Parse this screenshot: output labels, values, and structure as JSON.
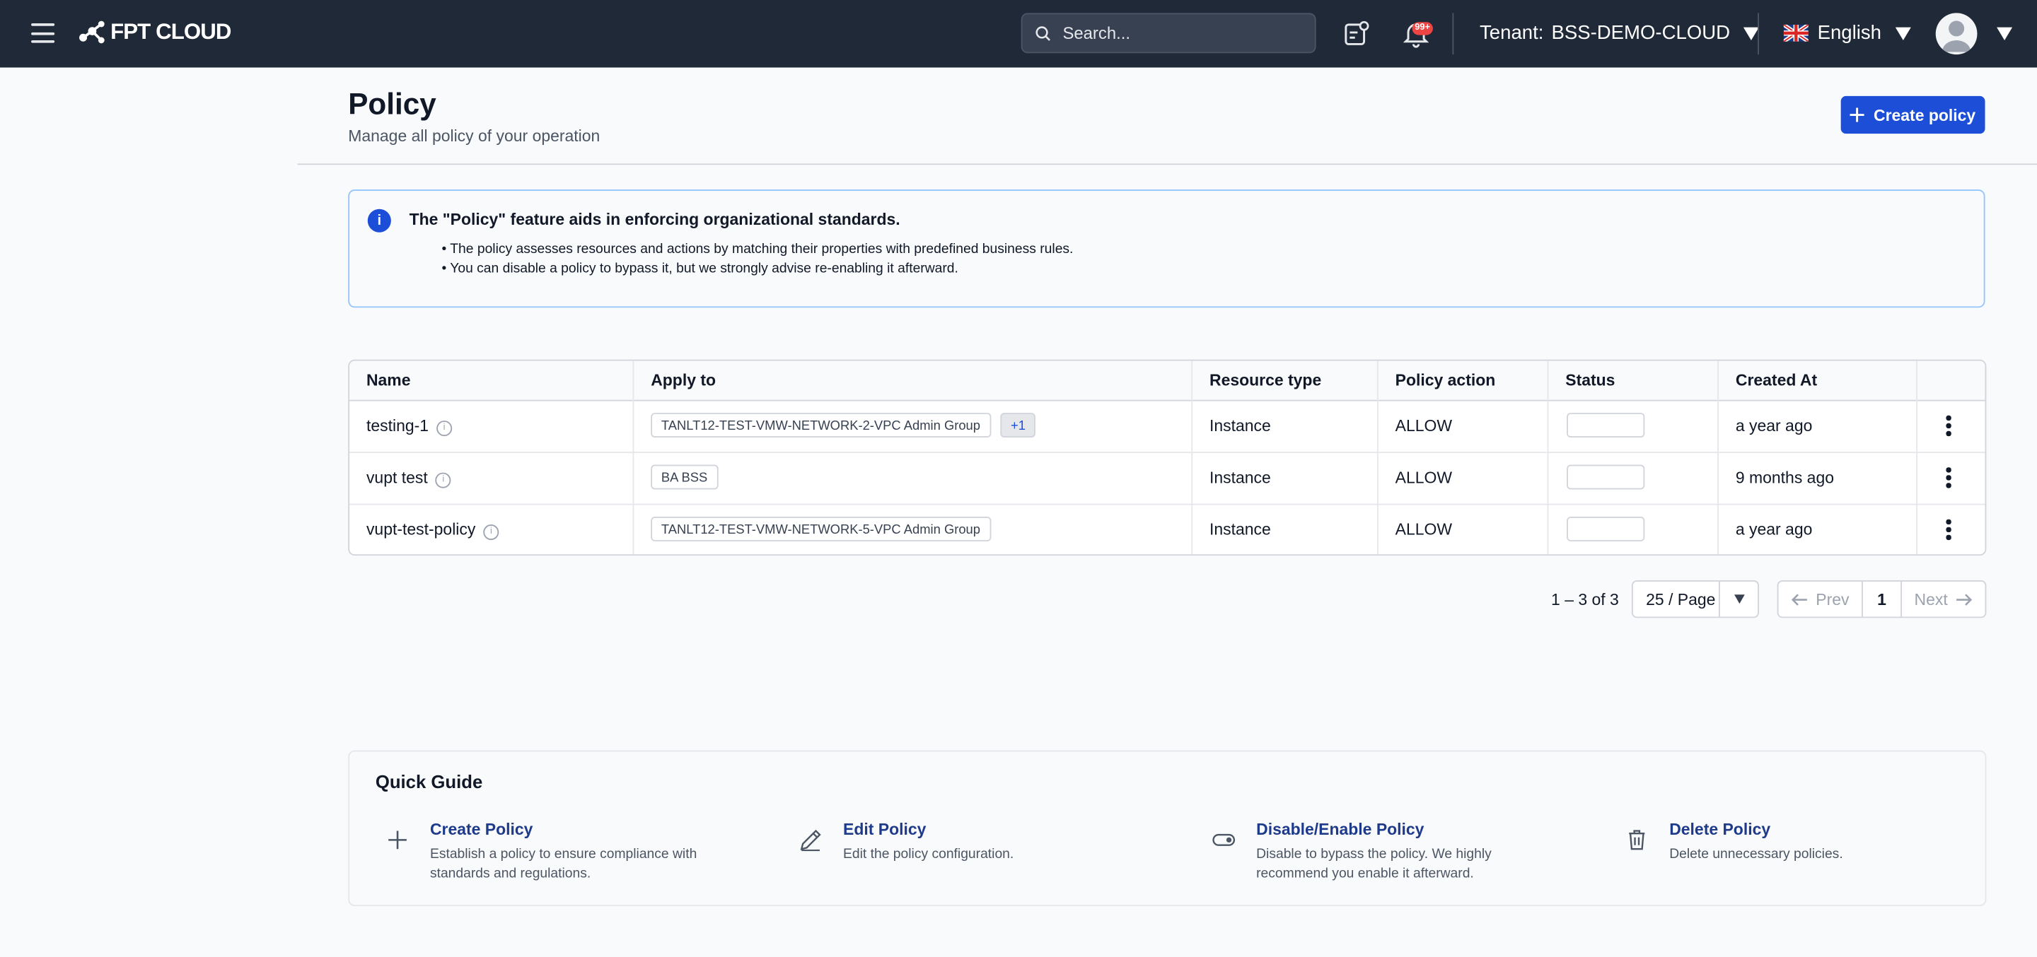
{
  "header": {
    "logo_text": "FPT CLOUD",
    "search_placeholder": "Search...",
    "notification_badge": "99+",
    "tenant_label": "Tenant:",
    "tenant_value": "BSS-DEMO-CLOUD",
    "language": "English"
  },
  "page": {
    "title": "Policy",
    "subtitle": "Manage all policy of your operation",
    "create_button": "Create policy"
  },
  "info": {
    "title": "The \"Policy\" feature aids in enforcing organizational standards.",
    "points": [
      "The policy assesses resources and actions by matching their properties with predefined business rules.",
      "You can disable a policy to bypass it, but we strongly advise re-enabling it afterward."
    ]
  },
  "table": {
    "columns": [
      "Name",
      "Apply to",
      "Resource type",
      "Policy action",
      "Status",
      "Created At"
    ],
    "rows": [
      {
        "name": "testing-1",
        "apply_to": "TANLT12-TEST-VMW-NETWORK-2-VPC Admin Group",
        "extra": "+1",
        "resource_type": "Instance",
        "policy_action": "ALLOW",
        "created_at": "a year ago"
      },
      {
        "name": "vupt test",
        "apply_to": "BA BSS",
        "extra": "",
        "resource_type": "Instance",
        "policy_action": "ALLOW",
        "created_at": "9 months ago"
      },
      {
        "name": "vupt-test-policy",
        "apply_to": "TANLT12-TEST-VMW-NETWORK-5-VPC Admin Group",
        "extra": "",
        "resource_type": "Instance",
        "policy_action": "ALLOW",
        "created_at": "a year ago"
      }
    ]
  },
  "pagination": {
    "range": "1 – 3 of 3",
    "per_page": "25 / Page",
    "prev": "Prev",
    "page": "1",
    "next": "Next"
  },
  "guide": {
    "title": "Quick Guide",
    "items": [
      {
        "title": "Create Policy",
        "desc": "Establish a policy to ensure compliance with standards and regulations.",
        "icon": "plus-icon"
      },
      {
        "title": "Edit Policy",
        "desc": "Edit the policy configuration.",
        "icon": "pencil-icon"
      },
      {
        "title": "Disable/Enable Policy",
        "desc": "Disable to bypass the policy. We highly recommend you enable it afterward.",
        "icon": "toggle-icon"
      },
      {
        "title": "Delete Policy",
        "desc": "Delete unnecessary policies.",
        "icon": "trash-icon"
      }
    ]
  },
  "colors": {
    "header_bg": "#1f2937",
    "primary": "#1d4ed8",
    "link": "#1e3a8a"
  }
}
